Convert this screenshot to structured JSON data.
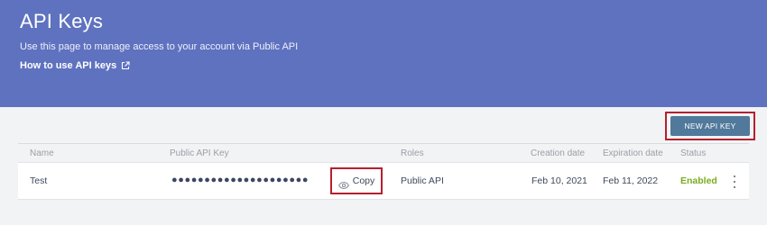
{
  "header": {
    "title": "API Keys",
    "subtitle": "Use this page to manage access to your account via Public API",
    "help_link_label": "How to use API keys",
    "help_link_icon": "external-link-icon"
  },
  "toolbar": {
    "new_key_label": "NEW API KEY"
  },
  "table": {
    "columns": [
      "Name",
      "Public API Key",
      "Roles",
      "Creation date",
      "Expiration date",
      "Status"
    ],
    "rows": [
      {
        "name": "Test",
        "key_masked": "●●●●●●●●●●●●●●●●●●●●●",
        "copy_label": "Copy",
        "copy_icon": "eye-icon",
        "role": "Public API",
        "created": "Feb 10, 2021",
        "expires": "Feb 11, 2022",
        "status": "Enabled",
        "menu_icon": "kebab-menu-icon"
      }
    ]
  },
  "colors": {
    "banner": "#5f72c0",
    "button": "#50799b",
    "status_enabled": "#7bab1f",
    "highlight": "#b5202e"
  }
}
